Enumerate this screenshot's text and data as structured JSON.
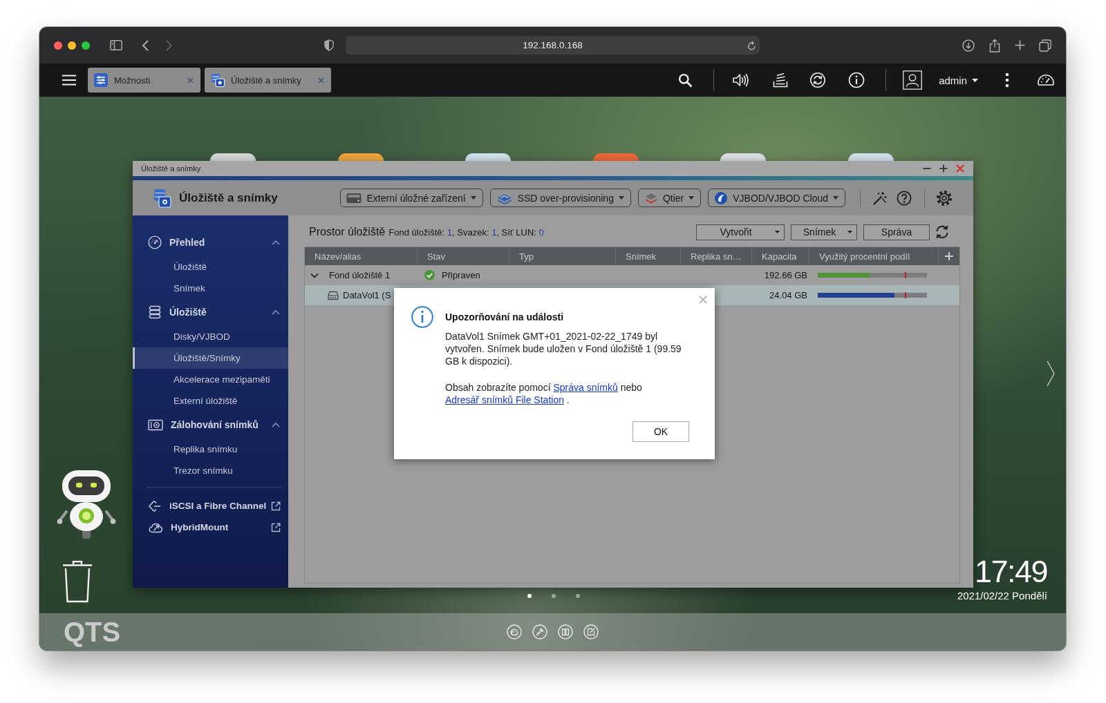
{
  "browser": {
    "address": "192.168.0.168"
  },
  "top_bar": {
    "tabs": [
      {
        "label": "Možnosti"
      },
      {
        "label": "Úložiště a snímky"
      }
    ],
    "user": "admin"
  },
  "app_window": {
    "title": "Úložiště a snímky",
    "app_name": "Úložiště a snímky",
    "menus": [
      "Externí úložné zařízení",
      "SSD over-provisioning",
      "Qtier",
      "VJBOD/VJBOD Cloud"
    ],
    "sidebar": {
      "sections": [
        {
          "label": "Přehled",
          "expanded": true,
          "items": [
            {
              "label": "Úložiště",
              "selected": false
            },
            {
              "label": "Snímek",
              "selected": false
            }
          ]
        },
        {
          "label": "Úložiště",
          "expanded": true,
          "items": [
            {
              "label": "Disky/VJBOD",
              "selected": false
            },
            {
              "label": "Úložiště/Snímky",
              "selected": true
            },
            {
              "label": "Akcelerace mezipaměti",
              "selected": false
            },
            {
              "label": "Externí úložiště",
              "selected": false
            }
          ]
        },
        {
          "label": "Zálohování snímků",
          "expanded": true,
          "items": [
            {
              "label": "Replika snímku",
              "selected": false
            },
            {
              "label": "Trezor snímku",
              "selected": false
            }
          ]
        }
      ],
      "links": [
        "iSCSI a Fibre Channel",
        "HybridMount"
      ]
    },
    "content": {
      "title": "Prostor úložiště",
      "summary": [
        {
          "kind": "label",
          "text": "Fond úložiště: "
        },
        {
          "kind": "value",
          "text": "1"
        },
        {
          "kind": "label",
          "text": ", Svazek: "
        },
        {
          "kind": "value",
          "text": "1"
        },
        {
          "kind": "label",
          "text": ", Síť LUN: "
        },
        {
          "kind": "value",
          "text": "0"
        }
      ],
      "actions": [
        {
          "label": "Vytvořit",
          "kind": "dropdown"
        },
        {
          "label": "Snímek",
          "kind": "dropdown"
        },
        {
          "label": "Správa",
          "kind": "button"
        }
      ],
      "table": {
        "columns": [
          "Název/alias",
          "Stav",
          "Typ",
          "Snímek",
          "Replika sn…",
          "Kapacita",
          "Využitý procentní podíl"
        ],
        "rows": [
          {
            "kind": "pool",
            "name": "Fond úložiště 1",
            "expanded": true,
            "selected": false,
            "status": "Připraven",
            "capacity": "192.66 GB",
            "level": 0.48,
            "color": "#4f9336"
          },
          {
            "kind": "volume",
            "name": "DataVol1 (S",
            "selected": true,
            "capacity": "24.04 GB",
            "level": 0.7,
            "color": "#243f8f"
          }
        ]
      }
    }
  },
  "dialog": {
    "title": "Upozorňování na události",
    "message": "DataVol1 Snímek GMT+01_2021-02-22_1749 byl vytvořen. Snímek bude uložen v Fond úložiště 1 (99.59 GB k dispozici).",
    "hint": [
      {
        "kind": "text",
        "text": "Obsah zobrazíte pomocí "
      },
      {
        "kind": "link",
        "text": "Správa snímků"
      },
      {
        "kind": "text",
        "text": " nebo "
      },
      {
        "kind": "link",
        "text": "Adresář snímků File Station"
      },
      {
        "kind": "text",
        "text": " ."
      }
    ],
    "button": "OK"
  },
  "desktop": {
    "time": "17:49",
    "date": "2021/02/22 Pondělí",
    "pages": [
      {
        "selected": true
      },
      {
        "selected": false
      },
      {
        "selected": false
      }
    ],
    "logo": "QTS"
  }
}
